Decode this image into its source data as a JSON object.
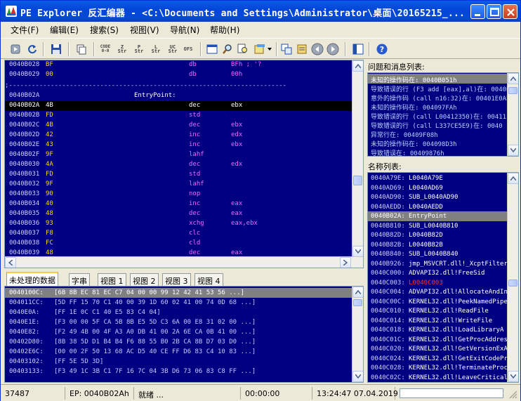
{
  "window": {
    "title": "PE Explorer 反汇编器 - <C:\\Documents and Settings\\Administrator\\桌面\\20165215_..."
  },
  "menu": [
    {
      "label": "文件(F)"
    },
    {
      "label": "编辑(E)"
    },
    {
      "label": "搜索(S)"
    },
    {
      "label": "视图(V)"
    },
    {
      "label": "导航(N)"
    },
    {
      "label": "帮助(H)"
    }
  ],
  "toolbar": {
    "icons": [
      "stop-icon",
      "refresh-icon",
      "save-icon",
      "copy-icon",
      "code-hex-icon",
      "string-z-icon",
      "string-p-icon",
      "string-l-icon",
      "string-uc-icon",
      "offset-icon",
      "window-icon",
      "search-icon",
      "search-next-icon",
      "options-icon",
      "goto-icon",
      "export-icon",
      "back-icon",
      "forward-icon",
      "panel-icon",
      "help-icon"
    ],
    "code_label": "CODE\n0-0",
    "z_label": "Z\nStr",
    "p_label": "P\nStr",
    "l_label": "L\nStr",
    "uc_label": "UC\nStr",
    "ofs_label": "OFS"
  },
  "disasm": {
    "separator": ";-------------------------------------------------------------------------",
    "label_row": {
      "addr": "0040B02A",
      "label": "EntryPoint:"
    },
    "pre_rows": [
      {
        "addr": "0040B028",
        "byte": "BF",
        "mn": "db",
        "op": "BFh  ;  '?"
      },
      {
        "addr": "0040B029",
        "byte": "00",
        "mn": "db",
        "op": "00h"
      }
    ],
    "rows": [
      {
        "addr": "0040B02A",
        "byte": "4B",
        "mn": "dec",
        "op": "ebx"
      },
      {
        "addr": "0040B02B",
        "byte": "FD",
        "mn": "std",
        "op": ""
      },
      {
        "addr": "0040B02C",
        "byte": "4B",
        "mn": "dec",
        "op": "ebx"
      },
      {
        "addr": "0040B02D",
        "byte": "42",
        "mn": "inc",
        "op": "edx"
      },
      {
        "addr": "0040B02E",
        "byte": "43",
        "mn": "inc",
        "op": "ebx"
      },
      {
        "addr": "0040B02F",
        "byte": "9F",
        "mn": "lahf",
        "op": ""
      },
      {
        "addr": "0040B030",
        "byte": "4A",
        "mn": "dec",
        "op": "edx"
      },
      {
        "addr": "0040B031",
        "byte": "FD",
        "mn": "std",
        "op": ""
      },
      {
        "addr": "0040B032",
        "byte": "9F",
        "mn": "lahf",
        "op": ""
      },
      {
        "addr": "0040B033",
        "byte": "90",
        "mn": "nop",
        "op": ""
      },
      {
        "addr": "0040B034",
        "byte": "40",
        "mn": "inc",
        "op": "eax"
      },
      {
        "addr": "0040B035",
        "byte": "48",
        "mn": "dec",
        "op": "eax"
      },
      {
        "addr": "0040B036",
        "byte": "93",
        "mn": "xchg",
        "op": "eax,ebx"
      },
      {
        "addr": "0040B037",
        "byte": "F8",
        "mn": "clc",
        "op": ""
      },
      {
        "addr": "0040B038",
        "byte": "FC",
        "mn": "cld",
        "op": ""
      },
      {
        "addr": "0040B039",
        "byte": "48",
        "mn": "dec",
        "op": "eax"
      }
    ]
  },
  "tabs": [
    {
      "label": "未处理的数据"
    },
    {
      "label": "字串"
    },
    {
      "label": "视图 1"
    },
    {
      "label": "视图 2"
    },
    {
      "label": "视图 3"
    },
    {
      "label": "视图 4"
    }
  ],
  "rawdata": [
    {
      "addr": "0040100C:",
      "bytes": "[6B 8B EC 81 EC C7 04 00 00 99 12 42 41 53 56 ...]"
    },
    {
      "addr": "004011CC:",
      "bytes": "[5D FF 15 70 C1 40 00 39 1D 60 02 41 00 74 0D 68 ...]"
    },
    {
      "addr": "0040E0A:",
      "bytes": "[FF 1E 0C C1 40 E5 83 C4 04]"
    },
    {
      "addr": "0040E1E:",
      "bytes": "[F3 00 00 5F CA 5B 8B E5 5D C3 6A 00 E8 31 02 00 ...]"
    },
    {
      "addr": "0040E82:",
      "bytes": "[F2 49 4B 00 4F A3 A0 DB 41 00 2A 6E CA 0B 41 00 ...]"
    },
    {
      "addr": "00402D80:",
      "bytes": "[8B 38 5D D1 B4 B4 F6 88 55 B0 2B CA 8B D7 03 D0 ...]"
    },
    {
      "addr": "00402E6C:",
      "bytes": "[00 00 2F 50 13 68 AC D5 40 CE FF D6 83 C4 10 83 ...]"
    },
    {
      "addr": "00403102:",
      "bytes": "[FF 5E 5D 3D]"
    },
    {
      "addr": "00403133:",
      "bytes": "[F3 49 1C 3B C1 7F 16 7C 04 3B D6 73 06 83 C8 FF ...]"
    }
  ],
  "issues": {
    "header": "问题和消息列表:",
    "rows": [
      {
        "text": "未知的操作码在: 0040B051h"
      },
      {
        "text": "导致错误的行 (F3 add   [eax],al)在: 0040B04D"
      },
      {
        "text": "意外的操作码 (call n16:32)在: 00401E0Ah"
      },
      {
        "text": "未知的操作码在: 004097FAh"
      },
      {
        "text": "导致错误的行 (call     L00412350)在: 00411"
      },
      {
        "text": "导致错误的行 (call     L337CE5E9)在: 0040"
      },
      {
        "text": "异常行在: 00409F08h"
      },
      {
        "text": "未知的操作码在: 004098D3h"
      },
      {
        "text": "导致错误在: 00409876h"
      }
    ]
  },
  "names": {
    "header": "名称列表:",
    "rows": [
      {
        "addr": "0040A79E:",
        "name": "L0040A79E",
        "color": "#ffffff"
      },
      {
        "addr": "0040AD69:",
        "name": "L0040AD69",
        "color": "#ffffff"
      },
      {
        "addr": "0040AD90:",
        "name": "SUB_L0040AD90",
        "color": "#ffffff"
      },
      {
        "addr": "0040AEDD:",
        "name": "L0040AEDD",
        "color": "#ffffff"
      },
      {
        "addr": "0040B02A:",
        "name": "EntryPoint",
        "color": "#ffffff"
      },
      {
        "addr": "0040B810:",
        "name": "SUB_L0040B810",
        "color": "#ffffff"
      },
      {
        "addr": "0040B82D:",
        "name": "L0040B82D",
        "color": "#ffffff"
      },
      {
        "addr": "0040B82B:",
        "name": "L0040B82B",
        "color": "#ffffff"
      },
      {
        "addr": "0040B840:",
        "name": "SUB_L0040B840",
        "color": "#ffffff"
      },
      {
        "addr": "0040B926:",
        "name": "jmp_MSVCRT.dll!_XcptFilter",
        "color": "#ffffff"
      },
      {
        "addr": "0040C000:",
        "name": "ADVAPI32.dll!FreeSid",
        "color": "#ffffff"
      },
      {
        "addr": "0040C003:",
        "name": "L0040C003",
        "color": "#ff3030"
      },
      {
        "addr": "0040C004:",
        "name": "ADVAPI32.dll!AllocateAndInit",
        "color": "#ffffff"
      },
      {
        "addr": "0040C00C:",
        "name": "KERNEL32.dll!PeekNamedPipe",
        "color": "#ffffff"
      },
      {
        "addr": "0040C010:",
        "name": "KERNEL32.dll!ReadFile",
        "color": "#ffffff"
      },
      {
        "addr": "0040C014:",
        "name": "KERNEL32.dll!WriteFile",
        "color": "#ffffff"
      },
      {
        "addr": "0040C018:",
        "name": "KERNEL32.dll!LoadLibraryA",
        "color": "#ffffff"
      },
      {
        "addr": "0040C01C:",
        "name": "KERNEL32.dll!GetProcAddress",
        "color": "#ffffff"
      },
      {
        "addr": "0040C020:",
        "name": "KERNEL32.dll!GetVersionExA",
        "color": "#ffffff"
      },
      {
        "addr": "0040C024:",
        "name": "KERNEL32.dll!GetExitCodeProc",
        "color": "#ffffff"
      },
      {
        "addr": "0040C028:",
        "name": "KERNEL32.dll!TerminateProces",
        "color": "#ffffff"
      },
      {
        "addr": "0040C02C:",
        "name": "KERNEL32.dll!LeaveCriticalS",
        "color": "#ffffff"
      }
    ]
  },
  "status": {
    "count": "37487",
    "ep": "EP: 0040B02Ah",
    "state": "就绪 ...",
    "elapsed": "00:00:00",
    "datetime": "13:24:47 07.04.2019",
    "progress": 0
  },
  "colors": {
    "panel_bg": "#000080",
    "address": "#d0d0ff",
    "bytes": "#ffd030",
    "mnemonic": "#ff60ff",
    "operand": "#ff60ff",
    "label": "#ffffff"
  }
}
